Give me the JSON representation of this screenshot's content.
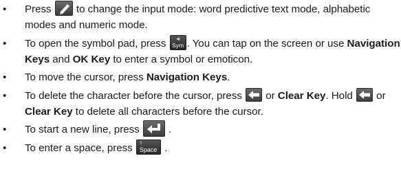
{
  "bullet_char": "•",
  "items": [
    {
      "p1": "Press",
      "icon": "pencil-icon",
      "p2": "to change the input mode: word predictive text mode, alphabetic modes and numeric mode."
    },
    {
      "p1": "To open the symbol pad, press",
      "key_label": "Sym",
      "p2": ". You can tap on the screen or use",
      "b1": "Navigation Keys",
      "p3": "and",
      "b2": "OK Key",
      "p4": "to enter a symbol or emoticon."
    },
    {
      "p1": "To move the cursor, press",
      "b1": "Navigation Keys",
      "p2": "."
    },
    {
      "p1": "To delete the character before the cursor, press",
      "icon": "backspace-icon",
      "p2": "or",
      "b1": "Clear Key",
      "p3": ". Hold",
      "p4": "or",
      "b2": "Clear Key",
      "p5": "to delete all characters before the cursor."
    },
    {
      "p1": "To start a new line, press",
      "icon": "enter-icon",
      "p2": "."
    },
    {
      "p1": "To enter a space, press",
      "key_label": "Space",
      "p2": "."
    }
  ]
}
